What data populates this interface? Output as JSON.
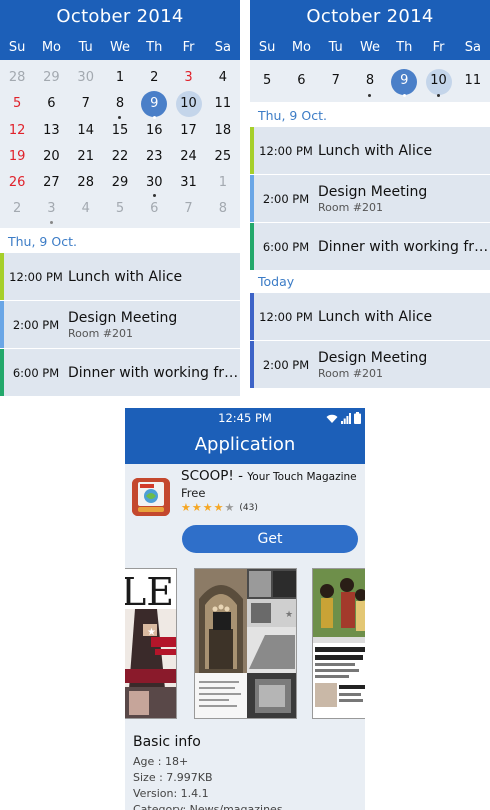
{
  "calendar_left": {
    "title": "October 2014",
    "weekdays": [
      "Su",
      "Mo",
      "Tu",
      "We",
      "Th",
      "Fr",
      "Sa"
    ],
    "weeks": [
      [
        "28",
        "29",
        "30",
        "1",
        "2",
        "3",
        "4"
      ],
      [
        "5",
        "6",
        "7",
        "8",
        "9",
        "10",
        "11"
      ],
      [
        "12",
        "13",
        "14",
        "15",
        "16",
        "17",
        "18"
      ],
      [
        "19",
        "20",
        "21",
        "22",
        "23",
        "24",
        "25"
      ],
      [
        "26",
        "27",
        "28",
        "29",
        "30",
        "31",
        "1"
      ],
      [
        "2",
        "3",
        "4",
        "5",
        "6",
        "7",
        "8"
      ]
    ],
    "section_label": "Thu, 9 Oct.",
    "events": [
      {
        "time": "12:00 PM",
        "title": "Lunch with Alice",
        "subtitle": "",
        "color": "#a6cf2a"
      },
      {
        "time": "2:00 PM",
        "title": "Design Meeting",
        "subtitle": "Room #201",
        "color": "#6aa6e6"
      },
      {
        "time": "6:00 PM",
        "title": "Dinner with working friends",
        "subtitle": "",
        "color": "#23a86b"
      }
    ]
  },
  "calendar_right": {
    "title": "October 2014",
    "weekdays": [
      "Su",
      "Mo",
      "Tu",
      "We",
      "Th",
      "Fr",
      "Sa"
    ],
    "week": [
      "5",
      "6",
      "7",
      "8",
      "9",
      "10",
      "11"
    ],
    "section_label": "Thu, 9 Oct.",
    "events": [
      {
        "time": "12:00 PM",
        "title": "Lunch with Alice",
        "subtitle": "",
        "color": "#a6cf2a"
      },
      {
        "time": "2:00 PM",
        "title": "Design Meeting",
        "subtitle": "Room #201",
        "color": "#6aa6e6"
      },
      {
        "time": "6:00 PM",
        "title": "Dinner with working friends",
        "subtitle": "",
        "color": "#23a86b"
      }
    ],
    "today_label": "Today",
    "today_events": [
      {
        "time": "12:00 PM",
        "title": "Lunch with Alice",
        "subtitle": "",
        "color": "#3d63c7"
      },
      {
        "time": "2:00 PM",
        "title": "Design Meeting",
        "subtitle": "Room #201",
        "color": "#3d63c7"
      }
    ]
  },
  "store": {
    "status_time": "12:45 PM",
    "app_bar_title": "Application",
    "app_name": "SCOOP! -",
    "app_tagline": "Your Touch Magazine",
    "price": "Free",
    "rating": 4,
    "rating_count": "(43)",
    "get_label": "Get",
    "basic_title": "Basic info",
    "basic_lines": [
      "Age : 18+",
      "Size : 7.997KB",
      "Version: 1.4.1",
      "Category: News/magazines"
    ]
  },
  "colors": {
    "header_blue": "#1c5fb8",
    "selected_day": "#4a7fc8",
    "today_day": "#c4d5ea",
    "sunday_red": "#e0222b",
    "section_label_blue": "#3c7cc6",
    "get_button": "#2f6fc9",
    "star_on": "#f5a623"
  },
  "icons": [
    "wifi-icon",
    "signal-icon",
    "battery-icon",
    "scoop-app-icon",
    "star-icon"
  ]
}
